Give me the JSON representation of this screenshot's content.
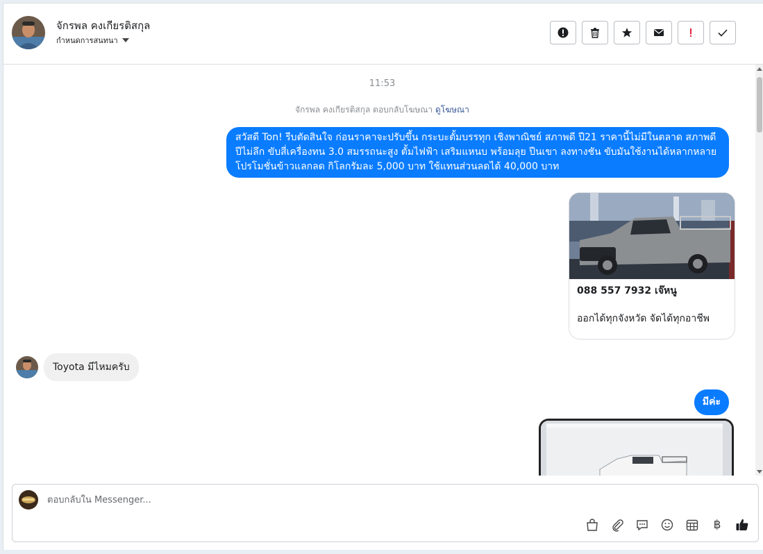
{
  "header": {
    "name": "จักรพล คงเกียรติสกุล",
    "assign_label": "กำหนดการสนทนา"
  },
  "thread": {
    "time": "11:53",
    "replied_text": "จักรพล คงเกียรติสกุล ตอบกลับโฆษณา",
    "view_ad_link": "ดูโฆษณา",
    "message_out_1": "สวัสดี Ton! รีบตัดสินใจ ก่อนราคาจะปรับขึ้น กระบะตั้มบรรทุก เชิงพาณิชย์ สภาพดี ปี21  ราคานี้ไม่มีในตลาด สภาพดีปีไม่ลึก ขับสี่เครื่องทน 3.0 สมรรถนะสูง ตั้มไฟฟ้า เสริมแหนบ พร้อมลุย ปีนเขา ลงทางชัน ขับมันใช้งานได้หลากหลาย โปรโมชั่นข้าวแลกลด กิโลกรัมละ 5,000 บาท ใช้แทนส่วนลดได้ 40,000 บาท",
    "card": {
      "title": "088 557 7932 เจ๊หนู",
      "subtitle": "ออกได้ทุกจังหวัด จัดได้ทุกอาชีพ"
    },
    "message_in_1": "Toyota มีไหมครับ",
    "message_out_2": "มีค่ะ"
  },
  "composer": {
    "placeholder": "ตอบกลับใน Messenger..."
  },
  "colors": {
    "accent": "#0a7cff",
    "incoming_bubble": "#f0f0f0"
  },
  "icons": {
    "toolbar": [
      "alert-circle-icon",
      "trash-icon",
      "star-icon",
      "envelope-icon",
      "exclamation-icon",
      "check-icon"
    ],
    "composer": [
      "shopping-bag-icon",
      "paperclip-icon",
      "speech-bubble-icon",
      "smiley-icon",
      "calendar-grid-icon",
      "baht-icon",
      "thumbs-up-icon"
    ]
  }
}
